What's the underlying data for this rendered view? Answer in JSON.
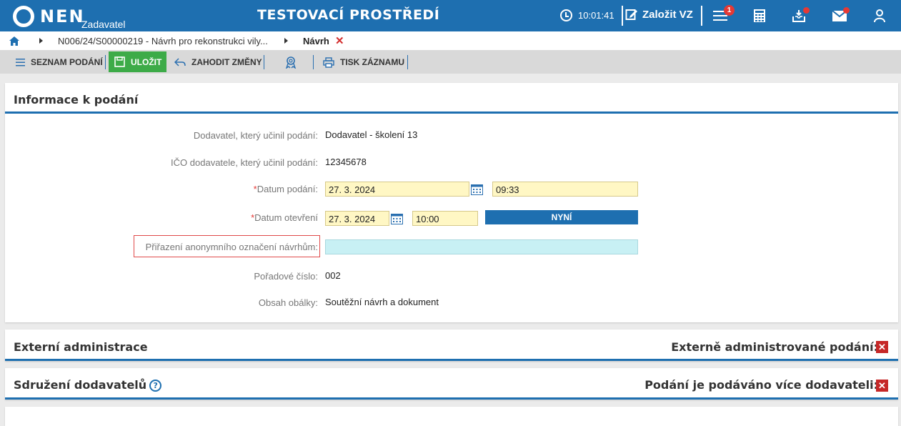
{
  "header": {
    "logo_text": "NEN",
    "logo_subtitle": "Zadavatel",
    "environment_title": "TESTOVACÍ PROSTŘEDÍ",
    "time": "10:01:41",
    "create_button_label": "Založit VZ",
    "notifications_badge": "1",
    "icons": [
      "clock-icon",
      "edit-icon",
      "menu-icon",
      "calculator-icon",
      "inbox-icon",
      "mail-icon",
      "user-icon"
    ]
  },
  "breadcrumb": {
    "items": [
      "N006/24/S00000219 - Návrh pro rekonstrukci vily...",
      "Návrh"
    ]
  },
  "toolbar": {
    "list_label": "SEZNAM PODÁNÍ",
    "save_label": "ULOŽIT",
    "discard_label": "ZAHODIT ZMĚNY",
    "print_label": "TISK ZÁZNAMU"
  },
  "info_panel": {
    "title": "Informace k podání",
    "supplier_label": "Dodavatel, který učinil podání:",
    "supplier_value": "Dodavatel - školení 13",
    "ico_label": "IČO dodavatele, který učinil podání:",
    "ico_value": "12345678",
    "submit_date_label": "Datum podání:",
    "submit_date_value": "27. 3. 2024",
    "submit_time_value": "09:33",
    "open_date_label": "Datum otevření",
    "open_date_value": "27. 3. 2024",
    "open_time_value": "10:00",
    "now_button_label": "NYNÍ",
    "anon_label": "Přiřazení anonymního označení návrhům:",
    "anon_value": "",
    "order_label": "Pořadové číslo:",
    "order_value": "002",
    "content_label": "Obsah obálky:",
    "content_value": "Soutěžní návrh a dokument",
    "required_mark": "*"
  },
  "external_panel": {
    "title": "Externí administrace",
    "right_label": "Externě administrované podání:"
  },
  "association_panel": {
    "title": "Sdružení dodavatelů",
    "right_label": "Podání je podáváno více dodavateli:"
  },
  "colors": {
    "brand_blue": "#1e6fb0",
    "save_green": "#3dab48",
    "required_red": "#e53935",
    "input_yellow": "#fff7c4",
    "input_cyan": "#c8f0f4"
  }
}
